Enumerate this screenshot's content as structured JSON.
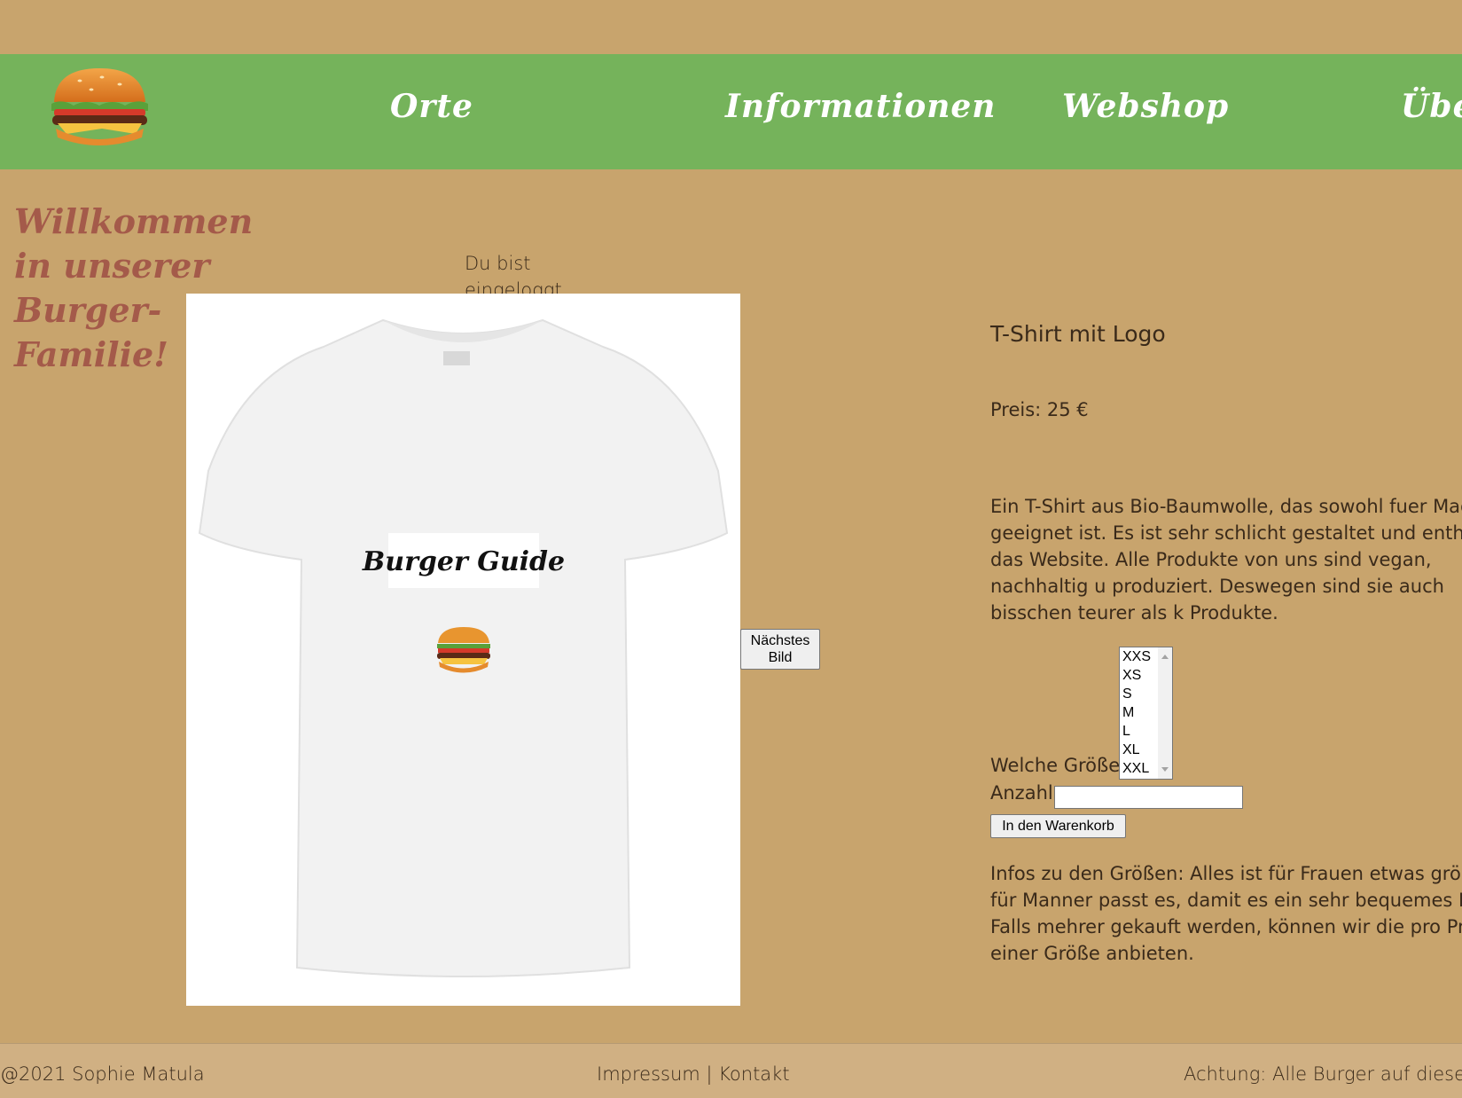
{
  "nav": {
    "logo_icon": "burger-icon",
    "items": [
      {
        "label": "Orte"
      },
      {
        "label": "Informationen"
      },
      {
        "label": "Webshop"
      },
      {
        "label": "Übe"
      }
    ]
  },
  "welcome": {
    "heading": "Willkommen in unserer Burger-Familie!"
  },
  "login_status": "Du bist eingeloggt",
  "product": {
    "image": {
      "print_text": "Burger Guide",
      "icon": "burger-icon"
    },
    "next_image_label": "Nächstes Bild",
    "title": "T-Shirt mit Logo",
    "price": "Preis: 25 €",
    "description": "Ein T-Shirt aus Bio-Baumwolle, das sowohl fuer Maenner geeignet ist. Es ist sehr schlicht gestaltet und enthaelt das Website. Alle Produkte von uns sind vegan, nachhaltig u produziert. Deswegen sind sie auch bisschen teurer als k Produkte.",
    "size_label": "Welche Größe:",
    "sizes": [
      "XXS",
      "XS",
      "S",
      "M",
      "L",
      "XL",
      "XXL"
    ],
    "quantity_label": "Anzahl",
    "quantity_value": "",
    "cart_button": "In den Warenkorb",
    "size_info": "Infos zu den Größen: Alles ist für Frauen etwas größer ge für Manner passt es, damit es ein sehr bequemes Kleidu Falls mehrer gekauft werden, können wir die pro Produk einer Größe anbieten."
  },
  "footer": {
    "copyright": "@2021 Sophie Matula",
    "impressum": "Impressum",
    "separator": "|",
    "kontakt": "Kontakt",
    "notice": "Achtung: Alle Burger auf dieser Se"
  }
}
